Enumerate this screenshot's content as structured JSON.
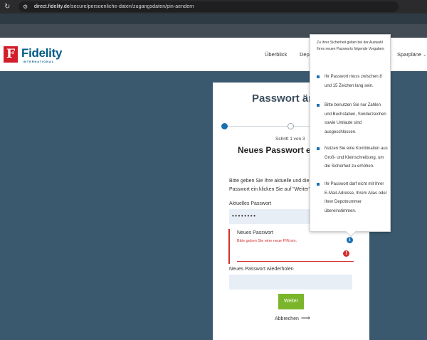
{
  "browser": {
    "url_host": "direct.fidelity.de",
    "url_path": "/secure/persoenliche-daten/zugangsdaten/pin-aendern"
  },
  "header": {
    "logo_word": "Fidelity",
    "logo_sub": "INTERNATIONAL",
    "nav": [
      {
        "label": "Überblick"
      },
      {
        "label": "Depo"
      },
      {
        "label": "Sparpläne"
      }
    ]
  },
  "card": {
    "title": "Passwort än",
    "step_text": "Schritt 1 von 3",
    "step_title": "Neues Passwort e",
    "intro_line1": "Bitte geben Sie Ihre aktuelle und die",
    "intro_line2": "Passwort ein klicken Sie auf \"Weiter\".",
    "current_label": "Aktuelles Passwort",
    "current_value": "••••••••",
    "new_label": "Neues Passwort",
    "new_error": "Bitte geben Sie eine neue PIN ein.",
    "repeat_label": "Neues Passwort wiederholen",
    "submit_label": "Weiter",
    "cancel_label": "Abbrechen"
  },
  "tooltip": {
    "intro": "Zu Ihrer Sicherheit gelten bei der Auswahl Ihres neuen Passworts folgende Vorgaben:",
    "items": [
      "Ihr Passwort muss zwischen 8 und 15 Zeichen lang sein.",
      "Bitte benutzen Sie nur Zahlen und Buchstaben, Sonderzeichen sowie Umlaute sind ausgeschlossen.",
      "Nutzen Sie eine Kombination aus Groß- und Kleinschreibung, um die Sicherheit zu erhöhen.",
      "Ihr Passwort darf nicht mit Ihrer E-Mail-Adresse, Ihrem Alias oder Ihrer Depotnummer übereinstimmen."
    ]
  },
  "colors": {
    "page_bg": "#3a596e",
    "brand_red": "#d21e2b",
    "brand_blue": "#005a85",
    "error_red": "#d32f2f",
    "submit_green": "#7bb52a"
  },
  "icons": {
    "reload": "reload-icon",
    "site": "site-info-icon",
    "info": "info-icon",
    "error": "error-icon",
    "arrow": "arrow-right-icon"
  }
}
